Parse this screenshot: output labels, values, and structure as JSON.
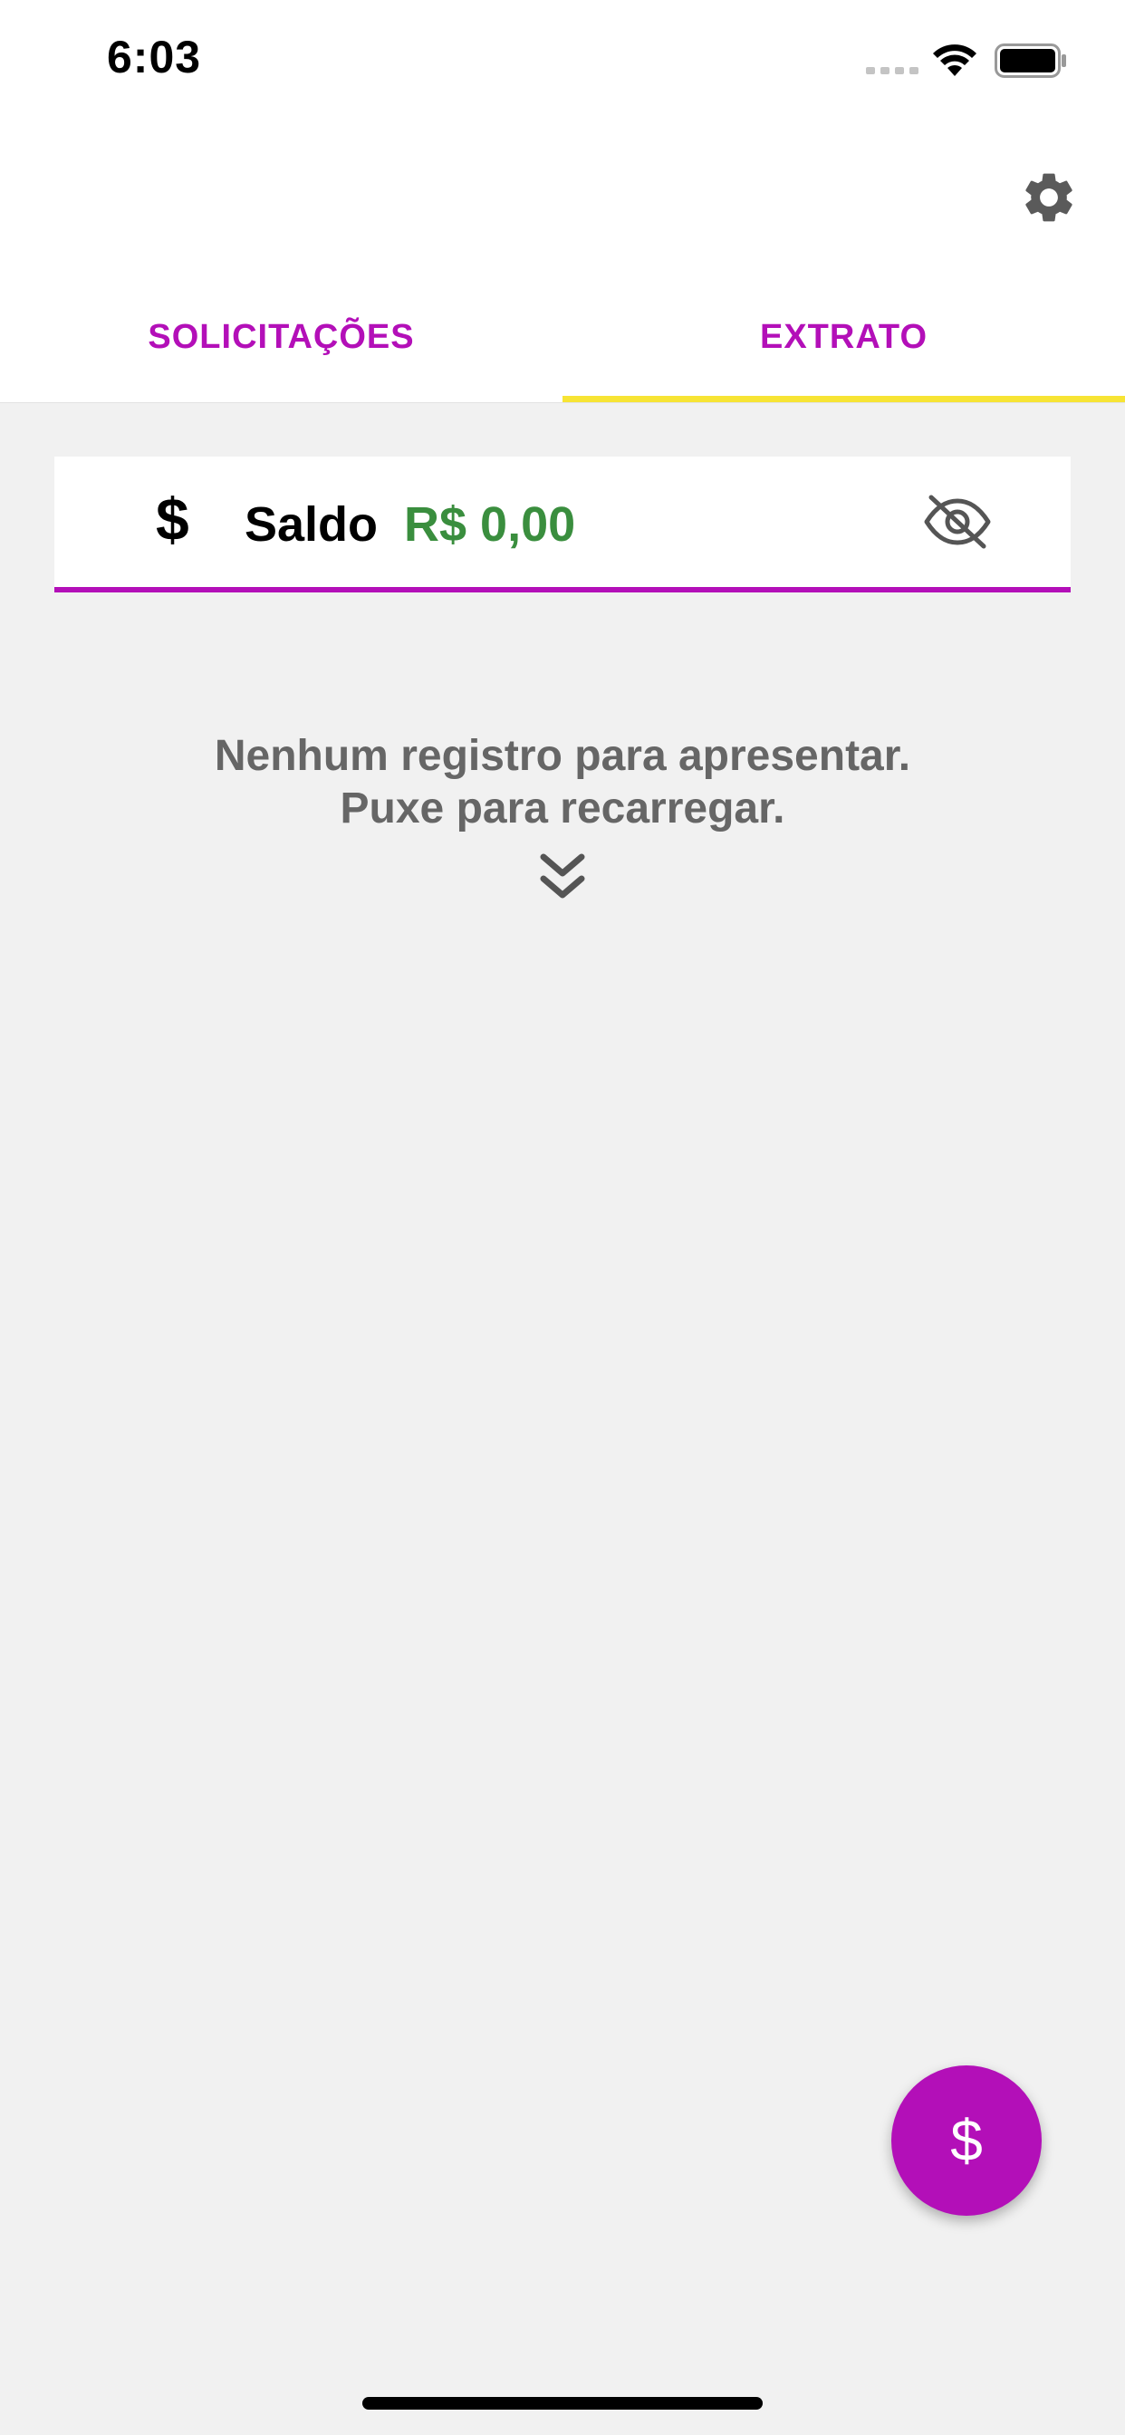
{
  "status_bar": {
    "time": "6:03"
  },
  "tabs": [
    {
      "label": "SOLICITAÇÕES",
      "active": false
    },
    {
      "label": "EXTRATO",
      "active": true
    }
  ],
  "balance": {
    "icon": "dollar-icon",
    "label": "Saldo",
    "value": "R$ 0,00",
    "visibility_icon": "eye-off-icon"
  },
  "empty_state": {
    "line1": "Nenhum registro para apresentar.",
    "line2": "Puxe para recarregar.",
    "icon": "chevron-double-down-icon"
  },
  "fab": {
    "label": "$",
    "icon": "dollar-icon"
  },
  "colors": {
    "accent": "#b30fb8",
    "tab_indicator": "#f7e434",
    "positive": "#3a8e3e",
    "muted_text": "#666666",
    "background": "#f1f1f1"
  }
}
